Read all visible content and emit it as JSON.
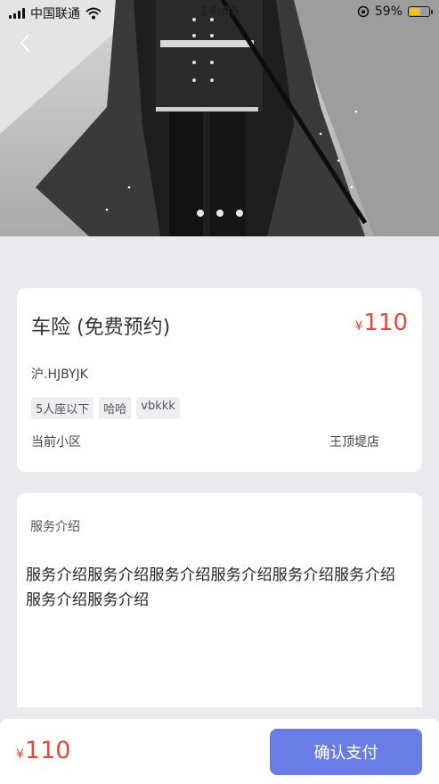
{
  "status_bar": {
    "carrier": "中国联通",
    "time": "14:05",
    "battery_percent": "59%",
    "battery_level": 0.59,
    "icons": [
      "signal-icon",
      "wifi-icon",
      "orientation-lock-icon",
      "battery-icon"
    ]
  },
  "hero": {
    "carousel_count": 3,
    "back_icon": "chevron-left-icon"
  },
  "service": {
    "title": "车险 (免费预约)",
    "currency": "¥",
    "price": "110",
    "plate": "沪.HJBYJK",
    "tags": [
      "5人座以下",
      "哈哈",
      "vbkkk"
    ],
    "community": "当前小区",
    "store": "王顶堤店"
  },
  "description": {
    "label": "服务介绍",
    "text": "服务介绍服务介绍服务介绍服务介绍服务介绍服务介绍服务介绍服务介绍"
  },
  "footer": {
    "currency": "¥",
    "price": "110",
    "confirm_label": "确认支付"
  },
  "colors": {
    "accent": "#6a7ce6",
    "price": "#e5483d",
    "background": "#e9e9ee"
  }
}
